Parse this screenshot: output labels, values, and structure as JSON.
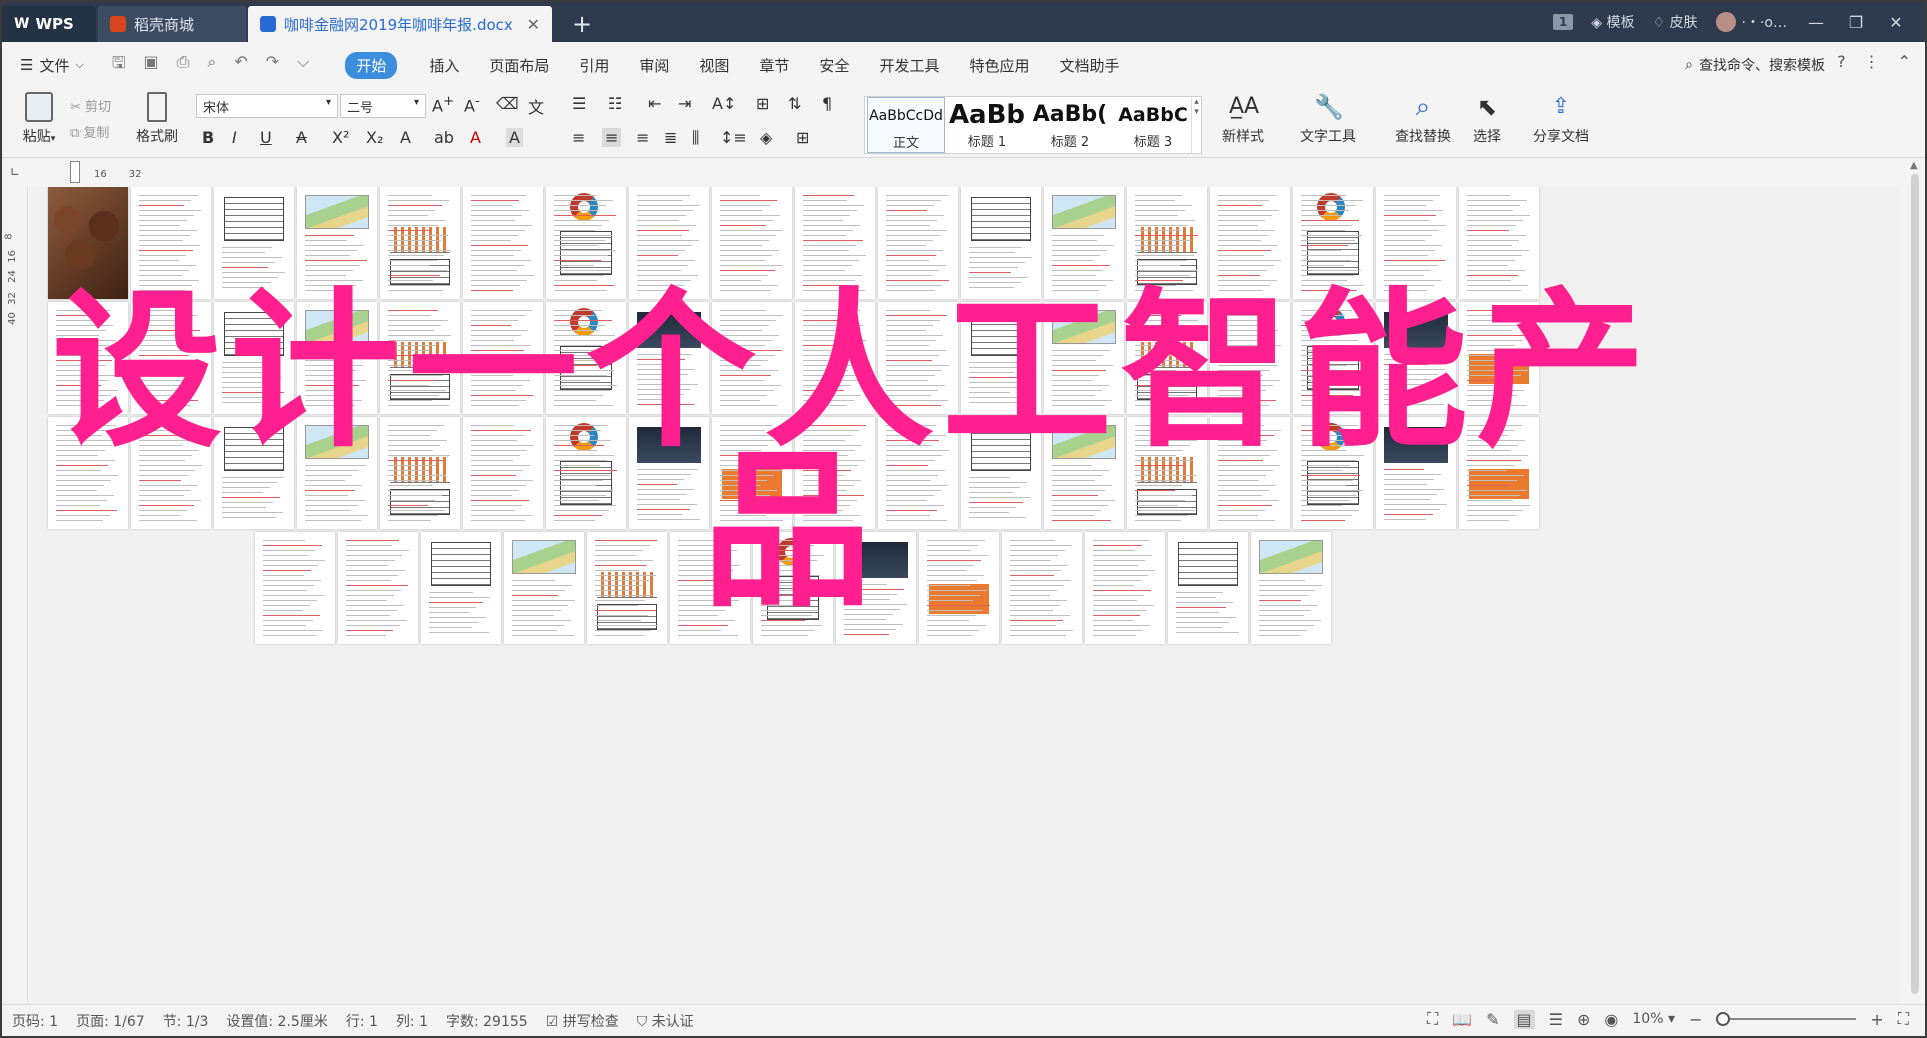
{
  "tabs": {
    "wps": "WPS",
    "store": "稻壳商城",
    "doc": "咖啡金融网2019年咖啡年报.docx",
    "add": "+"
  },
  "title_right": {
    "count": "1",
    "template": "模板",
    "skin": "皮肤",
    "user": "·・·o…"
  },
  "menu": {
    "file": "文件",
    "items": [
      "开始",
      "插入",
      "页面布局",
      "引用",
      "审阅",
      "视图",
      "章节",
      "安全",
      "开发工具",
      "特色应用",
      "文档助手"
    ],
    "search": "查找命令、搜索模板"
  },
  "ribbon": {
    "paste": "粘贴",
    "cut": "剪切",
    "copy": "复制",
    "format_painter": "格式刷",
    "font": "宋体",
    "size": "二号",
    "styles": [
      {
        "preview": "AaBbCcDd",
        "label": "正文"
      },
      {
        "preview": "AaBb",
        "label": "标题 1"
      },
      {
        "preview": "AaBb(",
        "label": "标题 2"
      },
      {
        "preview": "AaBbC",
        "label": "标题 3"
      }
    ],
    "new_style": "新样式",
    "text_tools": "文字工具",
    "find_replace": "查找替换",
    "select": "选择",
    "share": "分享文档"
  },
  "ruler": {
    "h": [
      "16",
      "32"
    ],
    "v": [
      "8",
      "16",
      "24",
      "32",
      "40"
    ]
  },
  "overlay": {
    "line1": "设计一个人工智能产",
    "line2": "品"
  },
  "status": {
    "page": "页码: 1",
    "pages": "页面: 1/67",
    "section": "节: 1/3",
    "setting": "设置值: 2.5厘米",
    "row": "行: 1",
    "col": "列: 1",
    "words": "字数: 29155",
    "spell": "拼写检查",
    "auth": "未认证",
    "zoom": "10%"
  },
  "colors": {
    "accent": "#3c8dde",
    "overlay": "#ff1f8e",
    "titlebar": "#2e3b4e"
  },
  "icons": [
    "search-icon",
    "help-icon",
    "more-icon",
    "paste-icon",
    "cut-icon",
    "copy-icon",
    "format-painter-icon",
    "bold-icon",
    "italic-icon",
    "underline-icon",
    "find-icon",
    "select-icon",
    "share-icon",
    "zoom-in-icon",
    "zoom-out-icon"
  ]
}
